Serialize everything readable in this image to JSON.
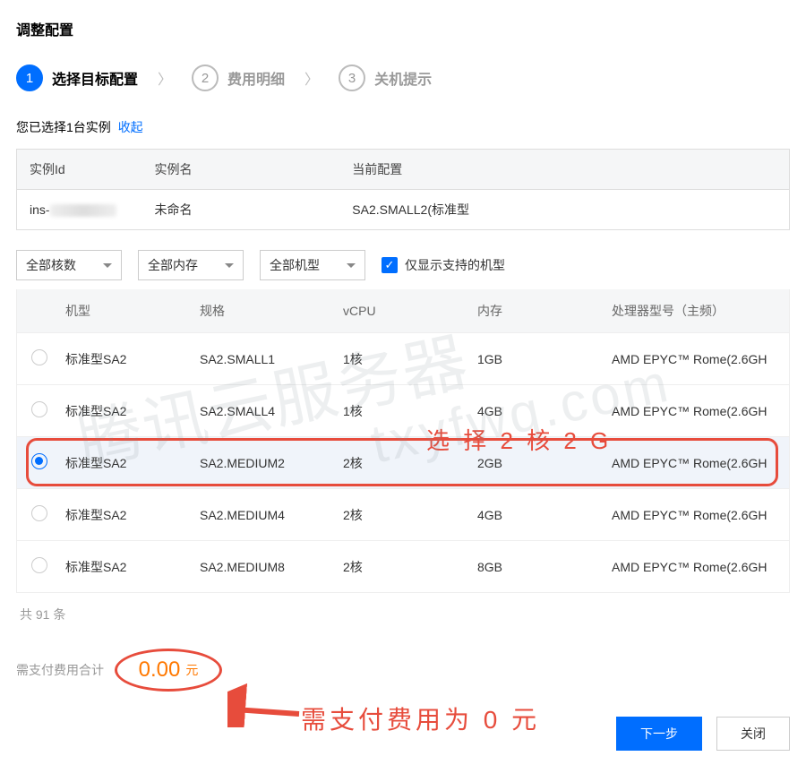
{
  "page_title": "调整配置",
  "steps": [
    {
      "num": "1",
      "label": "选择目标配置",
      "active": true
    },
    {
      "num": "2",
      "label": "费用明细",
      "active": false
    },
    {
      "num": "3",
      "label": "关机提示",
      "active": false
    }
  ],
  "selected_line_prefix": "您已选择1台实例",
  "collapse_text": "收起",
  "instance_table": {
    "headers": {
      "id": "实例Id",
      "name": "实例名",
      "config": "当前配置"
    },
    "row": {
      "id_prefix": "ins-",
      "name": "未命名",
      "config": "SA2.SMALL2(标准型"
    }
  },
  "filters": {
    "cores": "全部核数",
    "mem": "全部内存",
    "model": "全部机型",
    "only_supported": "仅显示支持的机型"
  },
  "spec_headers": {
    "model": "机型",
    "spec": "规格",
    "vcpu": "vCPU",
    "mem": "内存",
    "proc": "处理器型号（主频）"
  },
  "spec_rows": [
    {
      "model": "标准型SA2",
      "spec": "SA2.SMALL1",
      "vcpu": "1核",
      "mem": "1GB",
      "proc": "AMD EPYC™ Rome(2.6GH",
      "selected": false
    },
    {
      "model": "标准型SA2",
      "spec": "SA2.SMALL4",
      "vcpu": "1核",
      "mem": "4GB",
      "proc": "AMD EPYC™ Rome(2.6GH",
      "selected": false
    },
    {
      "model": "标准型SA2",
      "spec": "SA2.MEDIUM2",
      "vcpu": "2核",
      "mem": "2GB",
      "proc": "AMD EPYC™ Rome(2.6GH",
      "selected": true
    },
    {
      "model": "标准型SA2",
      "spec": "SA2.MEDIUM4",
      "vcpu": "2核",
      "mem": "4GB",
      "proc": "AMD EPYC™ Rome(2.6GH",
      "selected": false
    },
    {
      "model": "标准型SA2",
      "spec": "SA2.MEDIUM8",
      "vcpu": "2核",
      "mem": "8GB",
      "proc": "AMD EPYC™ Rome(2.6GH",
      "selected": false
    }
  ],
  "total_count": "共 91 条",
  "pay_label": "需支付费用合计",
  "pay_amount": "0.00",
  "pay_unit": "元",
  "btn_next": "下一步",
  "btn_close": "关闭",
  "annot_select": "选 择 2 核 2 G",
  "annot_pay": "需支付费用为 0 元",
  "watermark1": "腾讯云服务器",
  "watermark2": "txyfwq.com"
}
